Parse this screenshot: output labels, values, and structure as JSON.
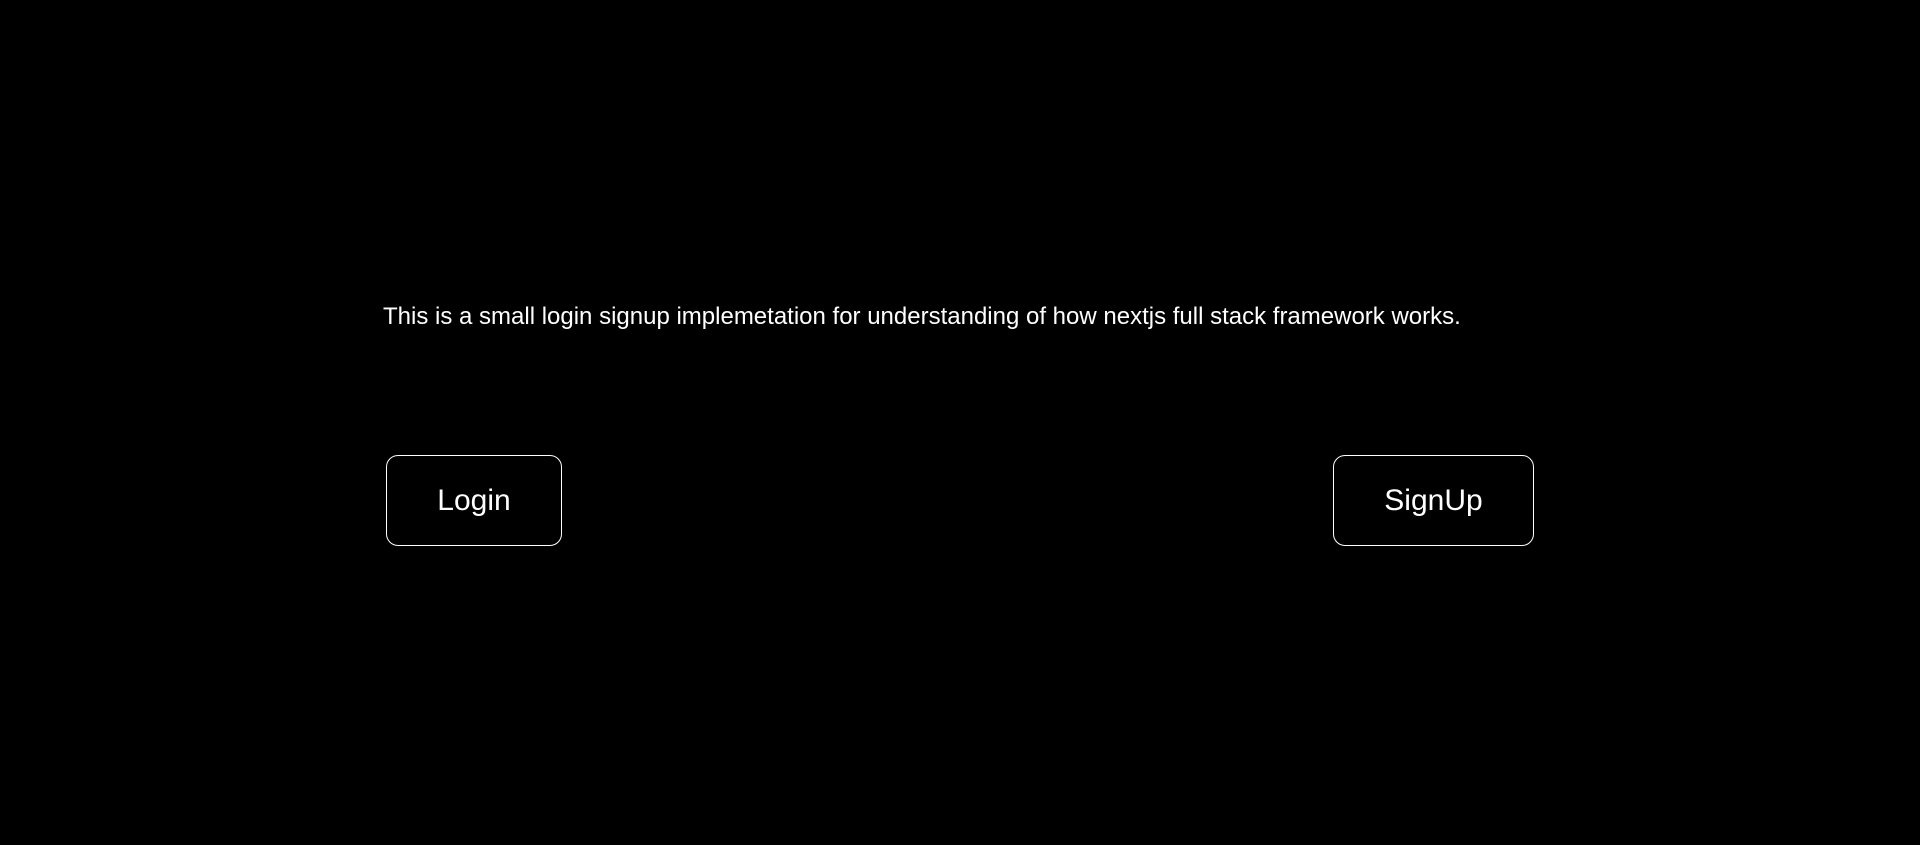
{
  "main": {
    "description": "This is a small login signup implemetation for understanding of how nextjs full stack framework works.",
    "login_label": "Login",
    "signup_label": "SignUp"
  },
  "colors": {
    "background": "#000000",
    "text": "#ffffff",
    "button_border": "#ffffff"
  }
}
